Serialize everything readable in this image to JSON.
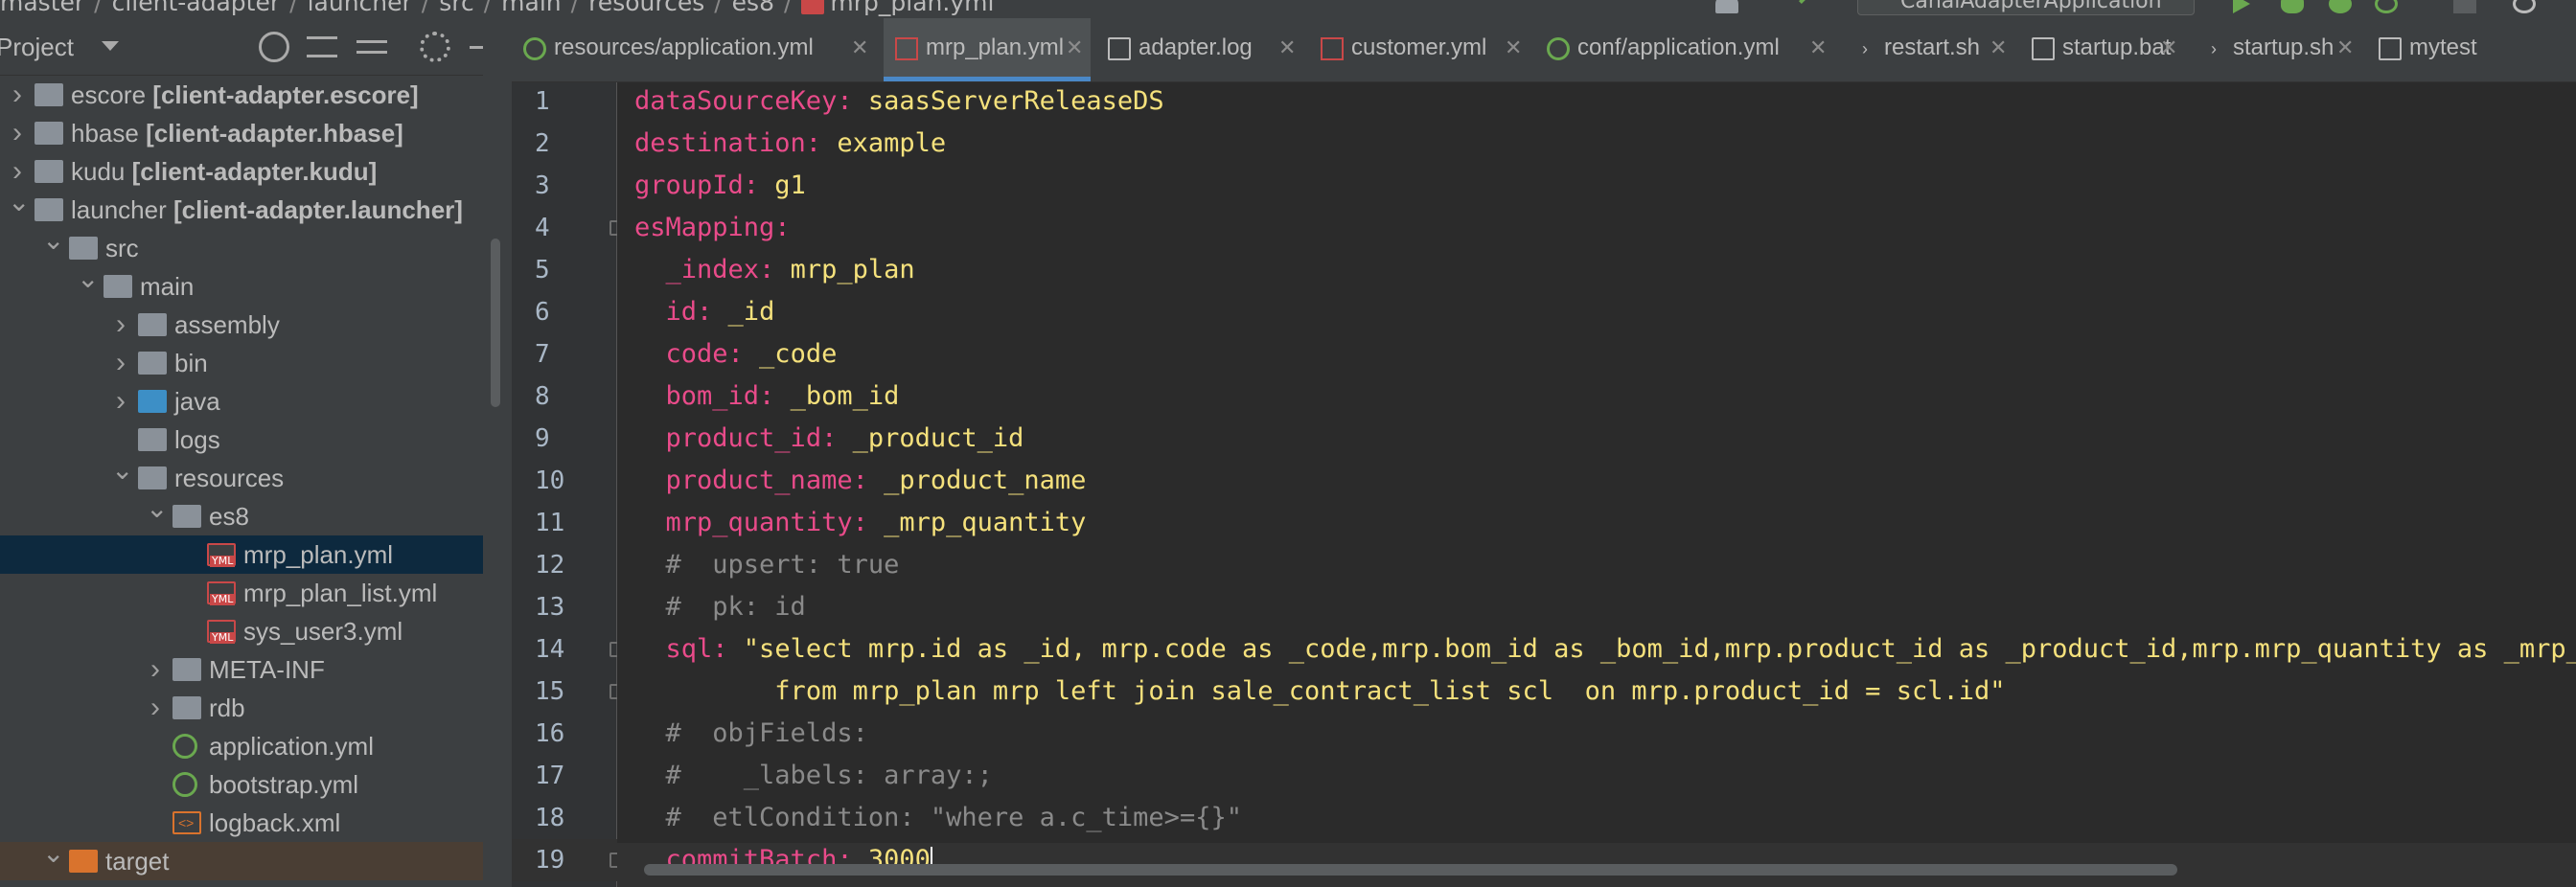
{
  "breadcrumb": [
    "master",
    "client-adapter",
    "launcher",
    "src",
    "main",
    "resources",
    "es8",
    "mrp_plan.yml"
  ],
  "toolbar": {
    "run_config": "CanalAdapterApplication"
  },
  "project_panel": {
    "title": "Project",
    "tree": [
      {
        "name": "escore",
        "module": "[client-adapter.escore]",
        "level": 0,
        "expanded": false,
        "type": "module"
      },
      {
        "name": "hbase",
        "module": "[client-adapter.hbase]",
        "level": 0,
        "expanded": false,
        "type": "module"
      },
      {
        "name": "kudu",
        "module": "[client-adapter.kudu]",
        "level": 0,
        "expanded": false,
        "type": "module"
      },
      {
        "name": "launcher",
        "module": "[client-adapter.launcher]",
        "level": 0,
        "expanded": true,
        "type": "module"
      },
      {
        "name": "src",
        "level": 1,
        "expanded": true,
        "type": "folder"
      },
      {
        "name": "main",
        "level": 2,
        "expanded": true,
        "type": "folder"
      },
      {
        "name": "assembly",
        "level": 3,
        "expanded": false,
        "type": "folder"
      },
      {
        "name": "bin",
        "level": 3,
        "expanded": false,
        "type": "folder"
      },
      {
        "name": "java",
        "level": 3,
        "expanded": false,
        "type": "folder-blue"
      },
      {
        "name": "logs",
        "level": 3,
        "type": "folder"
      },
      {
        "name": "resources",
        "level": 3,
        "expanded": true,
        "type": "folder-res"
      },
      {
        "name": "es8",
        "level": 4,
        "expanded": true,
        "type": "folder"
      },
      {
        "name": "mrp_plan.yml",
        "level": 5,
        "type": "yml",
        "selected": true
      },
      {
        "name": "mrp_plan_list.yml",
        "level": 5,
        "type": "yml"
      },
      {
        "name": "sys_user3.yml",
        "level": 5,
        "type": "yml"
      },
      {
        "name": "META-INF",
        "level": 4,
        "expanded": false,
        "type": "folder"
      },
      {
        "name": "rdb",
        "level": 4,
        "expanded": false,
        "type": "folder"
      },
      {
        "name": "application.yml",
        "level": 4,
        "type": "spring"
      },
      {
        "name": "bootstrap.yml",
        "level": 4,
        "type": "spring"
      },
      {
        "name": "logback.xml",
        "level": 4,
        "type": "xml"
      },
      {
        "name": "target",
        "level": 1,
        "expanded": true,
        "type": "folder-orange"
      }
    ]
  },
  "tabs": [
    {
      "label": "resources/application.yml",
      "icon": "spring-icon",
      "active": false
    },
    {
      "label": "mrp_plan.yml",
      "icon": "yml-icon",
      "active": true
    },
    {
      "label": "adapter.log",
      "icon": "file-icon",
      "active": false
    },
    {
      "label": "customer.yml",
      "icon": "yml-icon",
      "active": false
    },
    {
      "label": "conf/application.yml",
      "icon": "spring-icon",
      "active": false
    },
    {
      "label": "restart.sh",
      "icon": "shell-icon",
      "active": false
    },
    {
      "label": "startup.bat",
      "icon": "file-icon",
      "active": false
    },
    {
      "label": "startup.sh",
      "icon": "shell-icon",
      "active": false
    },
    {
      "label": "mytest",
      "icon": "file-icon",
      "active": false
    }
  ],
  "editor": {
    "lines": [
      {
        "n": "1",
        "key": "dataSourceKey:",
        "val": " saasServerReleaseDS",
        "indent": ""
      },
      {
        "n": "2",
        "key": "destination:",
        "val": " example",
        "indent": ""
      },
      {
        "n": "3",
        "key": "groupId:",
        "val": " g1",
        "indent": ""
      },
      {
        "n": "4",
        "key": "esMapping:",
        "val": "",
        "indent": ""
      },
      {
        "n": "5",
        "key": "_index:",
        "val": " mrp_plan",
        "indent": "  "
      },
      {
        "n": "6",
        "key": "id:",
        "val": " _id",
        "indent": "  "
      },
      {
        "n": "7",
        "key": "code:",
        "val": " _code",
        "indent": "  "
      },
      {
        "n": "8",
        "key": "bom_id:",
        "val": " _bom_id",
        "indent": "  "
      },
      {
        "n": "9",
        "key": "product_id:",
        "val": " _product_id",
        "indent": "  "
      },
      {
        "n": "10",
        "key": "product_name:",
        "val": " _product_name",
        "indent": "  "
      },
      {
        "n": "11",
        "key": "mrp_quantity:",
        "val": " _mrp_quantity",
        "indent": "  "
      },
      {
        "n": "12",
        "comment": "  #  upsert: true"
      },
      {
        "n": "13",
        "comment": "  #  pk: id"
      },
      {
        "n": "14",
        "key": "sql:",
        "val": " \"select mrp.id as _id, mrp.code as _code,mrp.bom_id as _bom_id,mrp.product_id as _product_id,mrp.mrp_quantity as _mrp_qu",
        "indent": "  "
      },
      {
        "n": "15",
        "key": "",
        "val": "       from mrp_plan mrp left join sale_contract_list scl  on mrp.product_id = scl.id\"",
        "indent": "  "
      },
      {
        "n": "16",
        "comment": "  #  objFields:"
      },
      {
        "n": "17",
        "comment": "  #    _labels: array:;"
      },
      {
        "n": "18",
        "comment": "  #  etlCondition: \"where a.c_time>={}\""
      },
      {
        "n": "19",
        "key": "commitBatch:",
        "val": " 3000",
        "indent": "  ",
        "current": true
      }
    ]
  }
}
